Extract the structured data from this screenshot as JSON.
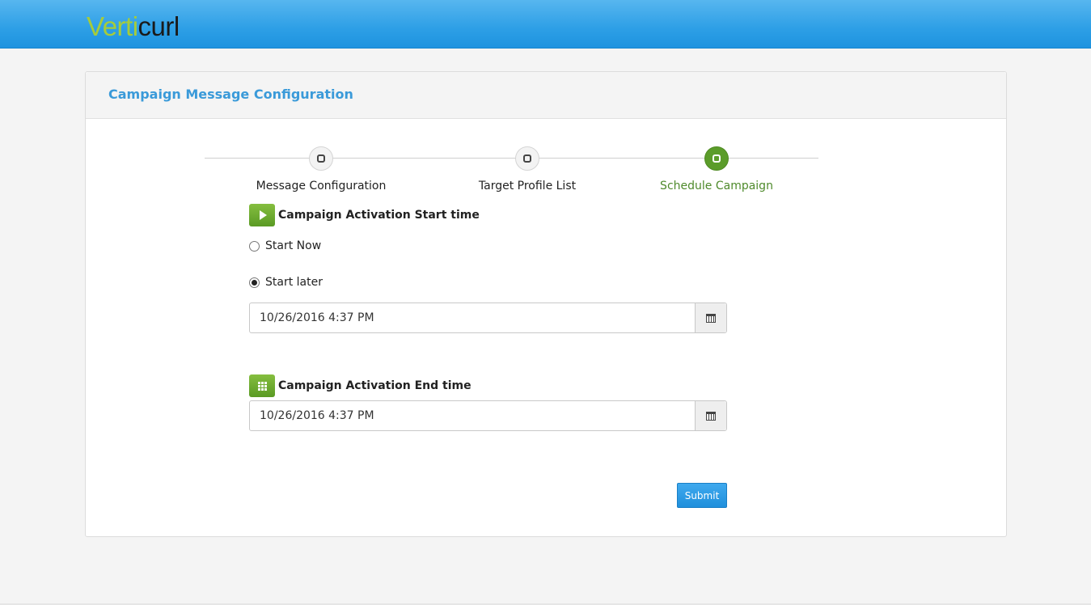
{
  "header": {
    "logo_part1": "Verti",
    "logo_part2": "curl"
  },
  "panel": {
    "title": "Campaign Message Configuration"
  },
  "steps": [
    {
      "label": "Message Configuration",
      "active": false
    },
    {
      "label": "Target Profile List",
      "active": false
    },
    {
      "label": "Schedule Campaign",
      "active": true
    }
  ],
  "start_section": {
    "title": "Campaign Activation Start time",
    "options": [
      {
        "label": "Start Now",
        "checked": false
      },
      {
        "label": "Start later",
        "checked": true
      }
    ],
    "datetime_value": "10/26/2016 4:37 PM"
  },
  "end_section": {
    "title": "Campaign Activation End time",
    "datetime_value": "10/26/2016 4:37 PM"
  },
  "submit_label": "Submit",
  "colors": {
    "accent_blue": "#3a9ad9",
    "active_green": "#5b9c2a",
    "logo_green": "#a6cc3a"
  },
  "icons": {
    "start_section_icon": "play-icon",
    "end_section_icon": "grid-icon",
    "datetime_button_icon": "calendar-icon"
  }
}
